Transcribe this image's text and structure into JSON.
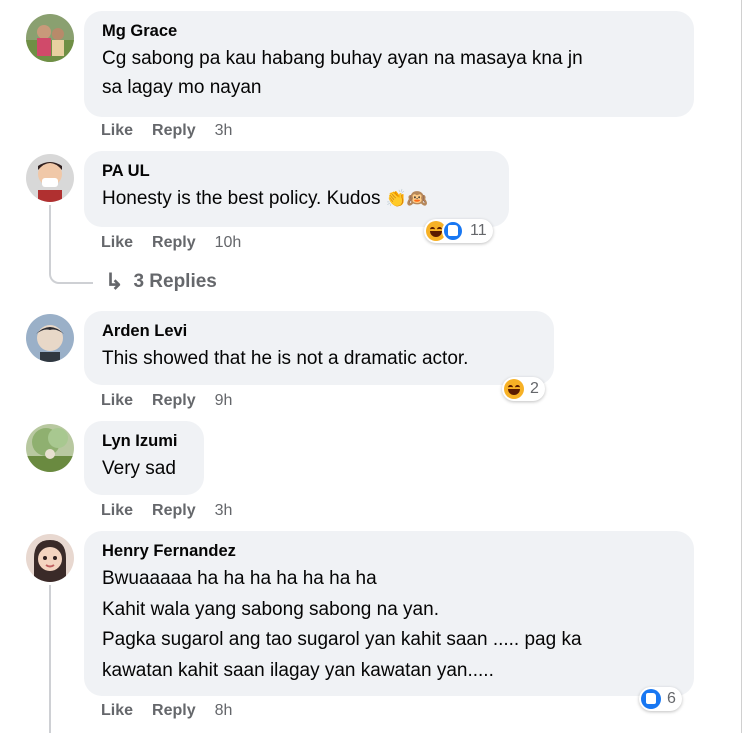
{
  "comments": [
    {
      "author": "Mg Grace",
      "text_lines": [
        "Cg sabong pa kau habang buhay ayan na masaya kna jn",
        "sa lagay mo nayan"
      ],
      "like": "Like",
      "reply": "Reply",
      "time": "3h"
    },
    {
      "author": "PA UL",
      "text": "Honesty is the best policy. Kudos",
      "emoji_suffix": "👏🙉",
      "like": "Like",
      "reply": "Reply",
      "time": "10h",
      "reaction_count": "11",
      "replies_label": "3 Replies"
    },
    {
      "author": "Arden Levi",
      "text": "This showed that he is not a dramatic actor.",
      "like": "Like",
      "reply": "Reply",
      "time": "9h",
      "reaction_count": "2"
    },
    {
      "author": "Lyn Izumi",
      "text": "Very sad",
      "like": "Like",
      "reply": "Reply",
      "time": "3h"
    },
    {
      "author": "Henry Fernandez",
      "text_lines": [
        "Bwuaaaaa ha ha ha ha ha ha ha",
        "Kahit wala yang sabong sabong na yan.",
        "Pagka sugarol ang tao sugarol yan kahit saan ..... pag ka",
        "kawatan kahit saan ilagay yan kawatan yan....."
      ],
      "like": "Like",
      "reply": "Reply",
      "time": "8h",
      "reaction_count": "6"
    }
  ],
  "icons": {
    "reply_arrow": "↳",
    "haha": "haha-reaction-icon",
    "like": "like-reaction-icon"
  },
  "colors": {
    "bubble": "#f0f2f5",
    "secondary_text": "#65676b",
    "like_blue": "#1877f2",
    "haha_yellow": "#f7b125"
  }
}
